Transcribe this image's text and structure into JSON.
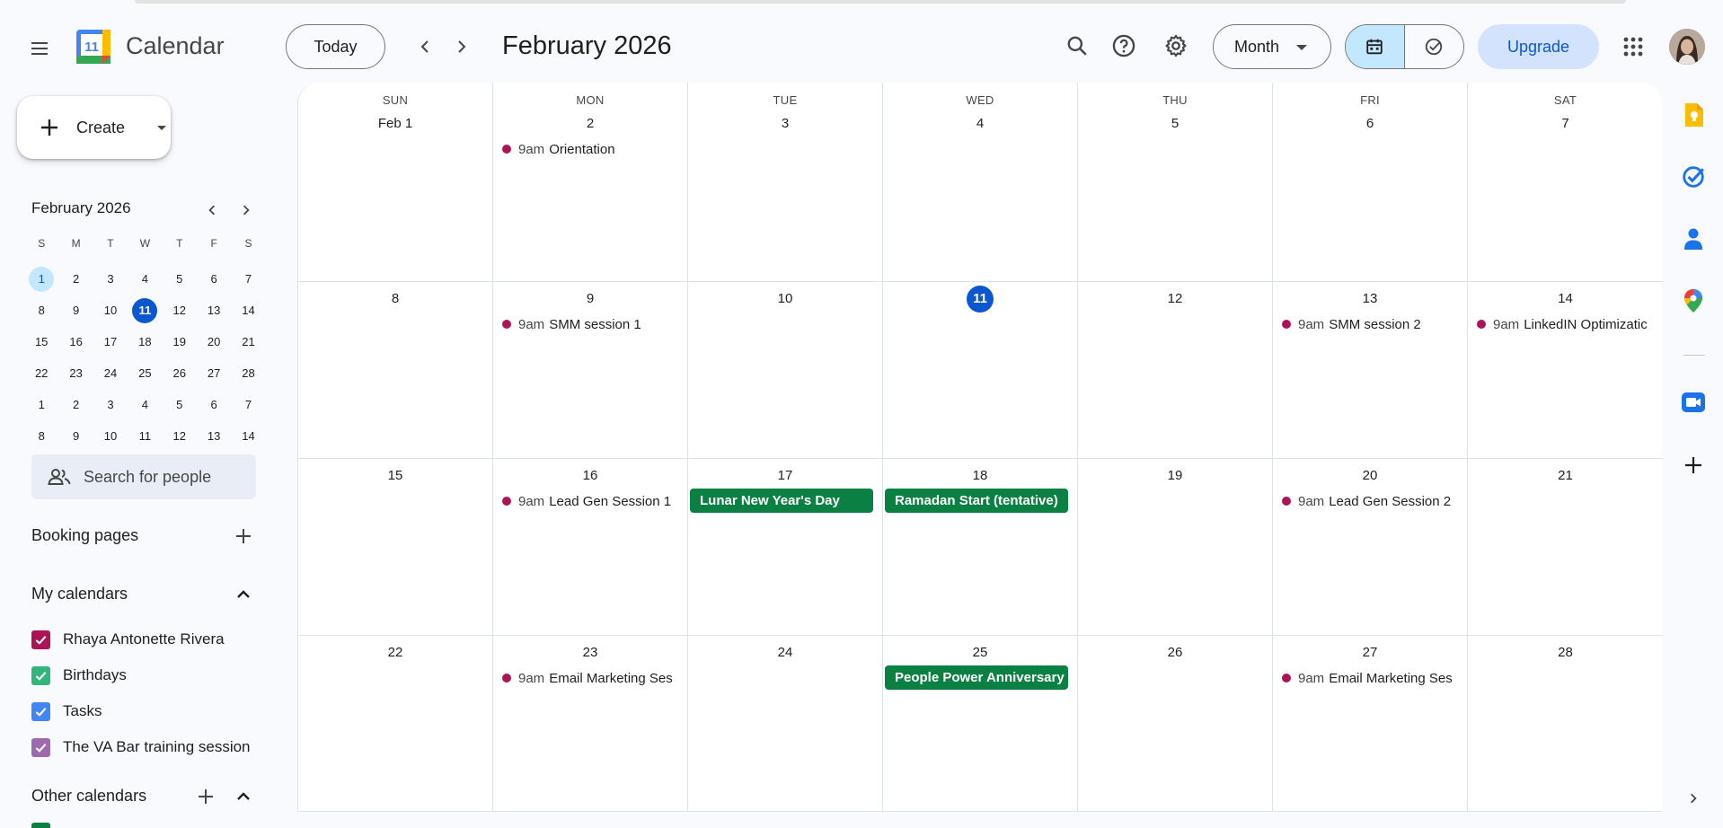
{
  "header": {
    "app_title": "Calendar",
    "logo_day": "11",
    "today_label": "Today",
    "current_period": "February 2026",
    "view_label": "Month",
    "upgrade_label": "Upgrade"
  },
  "sidebar": {
    "create_label": "Create",
    "mini_calendar": {
      "title": "February 2026",
      "weekday_initials": [
        "S",
        "M",
        "T",
        "W",
        "T",
        "F",
        "S"
      ],
      "weeks": [
        [
          "1",
          "2",
          "3",
          "4",
          "5",
          "6",
          "7"
        ],
        [
          "8",
          "9",
          "10",
          "11",
          "12",
          "13",
          "14"
        ],
        [
          "15",
          "16",
          "17",
          "18",
          "19",
          "20",
          "21"
        ],
        [
          "22",
          "23",
          "24",
          "25",
          "26",
          "27",
          "28"
        ],
        [
          "1",
          "2",
          "3",
          "4",
          "5",
          "6",
          "7"
        ],
        [
          "8",
          "9",
          "10",
          "11",
          "12",
          "13",
          "14"
        ]
      ]
    },
    "search_people_placeholder": "Search for people",
    "booking_pages_label": "Booking pages",
    "my_calendars_label": "My calendars",
    "my_calendars": [
      {
        "name": "Rhaya Antonette Rivera",
        "color": "#ad1457"
      },
      {
        "name": "Birthdays",
        "color": "#33b679"
      },
      {
        "name": "Tasks",
        "color": "#4285f4"
      },
      {
        "name": "The VA Bar training session",
        "color": "#9e69af"
      }
    ],
    "other_calendars_label": "Other calendars"
  },
  "calendar": {
    "weekday_names": [
      "SUN",
      "MON",
      "TUE",
      "WED",
      "THU",
      "FRI",
      "SAT"
    ],
    "weeks": [
      {
        "days": [
          {
            "label": "Feb 1",
            "events": []
          },
          {
            "label": "2",
            "events": [
              {
                "time": "9am",
                "title": "Orientation"
              }
            ]
          },
          {
            "label": "3",
            "events": []
          },
          {
            "label": "4",
            "events": []
          },
          {
            "label": "5",
            "events": []
          },
          {
            "label": "6",
            "events": []
          },
          {
            "label": "7",
            "events": []
          }
        ]
      },
      {
        "days": [
          {
            "label": "8",
            "events": []
          },
          {
            "label": "9",
            "events": [
              {
                "time": "9am",
                "title": "SMM session 1"
              }
            ]
          },
          {
            "label": "10",
            "events": []
          },
          {
            "label": "11",
            "today": true,
            "events": []
          },
          {
            "label": "12",
            "events": []
          },
          {
            "label": "13",
            "events": [
              {
                "time": "9am",
                "title": "SMM session 2"
              }
            ]
          },
          {
            "label": "14",
            "events": [
              {
                "time": "9am",
                "title": "LinkedIN Optimizatic"
              }
            ]
          }
        ]
      },
      {
        "days": [
          {
            "label": "15",
            "events": []
          },
          {
            "label": "16",
            "events": [
              {
                "time": "9am",
                "title": "Lead Gen Session 1"
              }
            ]
          },
          {
            "label": "17",
            "allday": "Lunar New Year's Day",
            "events": []
          },
          {
            "label": "18",
            "allday": "Ramadan Start (tentative)",
            "events": []
          },
          {
            "label": "19",
            "events": []
          },
          {
            "label": "20",
            "events": [
              {
                "time": "9am",
                "title": "Lead Gen Session 2"
              }
            ]
          },
          {
            "label": "21",
            "events": []
          }
        ]
      },
      {
        "days": [
          {
            "label": "22",
            "events": []
          },
          {
            "label": "23",
            "events": [
              {
                "time": "9am",
                "title": "Email Marketing Ses"
              }
            ]
          },
          {
            "label": "24",
            "events": []
          },
          {
            "label": "25",
            "allday": "People Power Anniversary",
            "events": []
          },
          {
            "label": "26",
            "events": []
          },
          {
            "label": "27",
            "events": [
              {
                "time": "9am",
                "title": "Email Marketing Ses"
              }
            ]
          },
          {
            "label": "28",
            "events": []
          }
        ]
      }
    ]
  },
  "colors": {
    "accent": "#0b57d0",
    "holiday_green": "#0b8043",
    "event_dot": "#ad1457"
  },
  "right_panel_icons": [
    "keep-icon",
    "tasks-icon",
    "contacts-icon",
    "maps-icon",
    "meet-icon",
    "add-icon",
    "chevron-right-icon"
  ]
}
